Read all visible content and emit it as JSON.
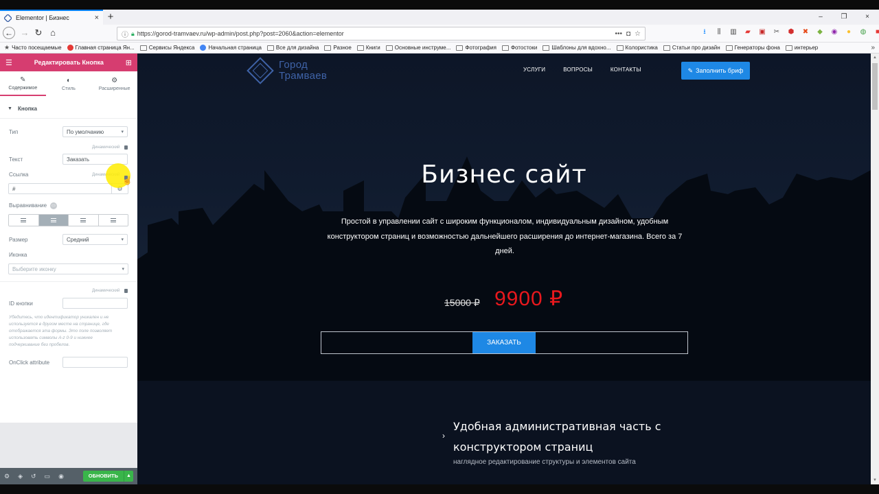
{
  "browser": {
    "tab_title": "Elementor | Бизнес",
    "tab_close": "×",
    "new_tab": "+",
    "url": "https://gorod-tramvaev.ru/wp-admin/post.php?post=2060&action=elementor",
    "url_more": "•••",
    "window_controls": [
      "–",
      "❐",
      "×"
    ],
    "bookmarks": [
      {
        "label": "Часто посещаемые",
        "icon": "star-icon"
      },
      {
        "label": "Главная страница Ян...",
        "icon": "yandex-icon"
      },
      {
        "label": "Сервисы Яндекса",
        "icon": "folder-icon"
      },
      {
        "label": "Начальная страница",
        "icon": "chrome-icon"
      },
      {
        "label": "Все для дизайна",
        "icon": "folder-icon"
      },
      {
        "label": "Разное",
        "icon": "folder-icon"
      },
      {
        "label": "Книги",
        "icon": "folder-icon"
      },
      {
        "label": "Основные инструме...",
        "icon": "folder-icon"
      },
      {
        "label": "Фотография",
        "icon": "folder-icon"
      },
      {
        "label": "Фотостоки",
        "icon": "folder-icon"
      },
      {
        "label": "Шаблоны для вдохно...",
        "icon": "folder-icon"
      },
      {
        "label": "Колористика",
        "icon": "folder-icon"
      },
      {
        "label": "Статьи про дизайн",
        "icon": "folder-icon"
      },
      {
        "label": "Генераторы фона",
        "icon": "folder-icon"
      },
      {
        "label": "интерьер",
        "icon": "folder-icon"
      }
    ],
    "bookmarks_more": "»"
  },
  "panel": {
    "header_title": "Редактировать Кнопка",
    "tabs": [
      {
        "label": "Содержимое",
        "icon": "pencil-icon"
      },
      {
        "label": "Стиль",
        "icon": "contrast-icon"
      },
      {
        "label": "Расширенные",
        "icon": "gear-icon"
      }
    ],
    "section_title": "Кнопка",
    "type_label": "Тип",
    "type_value": "По умолчанию",
    "dynamic_label": "Динамический",
    "text_label": "Текст",
    "text_value": "Заказать",
    "link_label": "Ссылка",
    "link_value": "#",
    "align_label": "Выравнивание",
    "size_label": "Размер",
    "size_value": "Средний",
    "icon_label": "Иконка",
    "icon_placeholder": "Выберите иконку",
    "button_id_label": "ID кнопки",
    "hint": "Убедитесь, что идентификатор уникален и не используется в другом месте на странице, где отображается эта формы. Это поле позволяет использовать символы A-z   0-9 и нижнее подчеркивание без пробелов.",
    "onclick_label": "OnClick attribute",
    "update_label": "ОБНОВИТЬ"
  },
  "site": {
    "logo_line1": "Город",
    "logo_line2": "Трамваев",
    "menu": [
      "УСЛУГИ",
      "ВОПРОСЫ",
      "КОНТАКТЫ"
    ],
    "cta_top": "Заполнить бриф",
    "hero_title": "Бизнес сайт",
    "hero_desc": "Простой в управлении сайт с широким функционалом, индивидуальным дизайном, удобным конструктором страниц и возможностью дальнейшего расширения до интернет-магазина. Всего за 7 дней.",
    "price_old": "15000 ₽",
    "price_new": "9900 ₽",
    "order_button": "ЗАКАЗАТЬ",
    "feature_title": "Удобная административная часть с конструктором страниц",
    "feature_sub": "наглядное редактирование структуры и элементов сайта"
  },
  "colors": {
    "elementor_accent": "#d63d70",
    "primary_blue": "#1e88e5",
    "price_red": "#e8181d",
    "update_green": "#39b54a"
  }
}
